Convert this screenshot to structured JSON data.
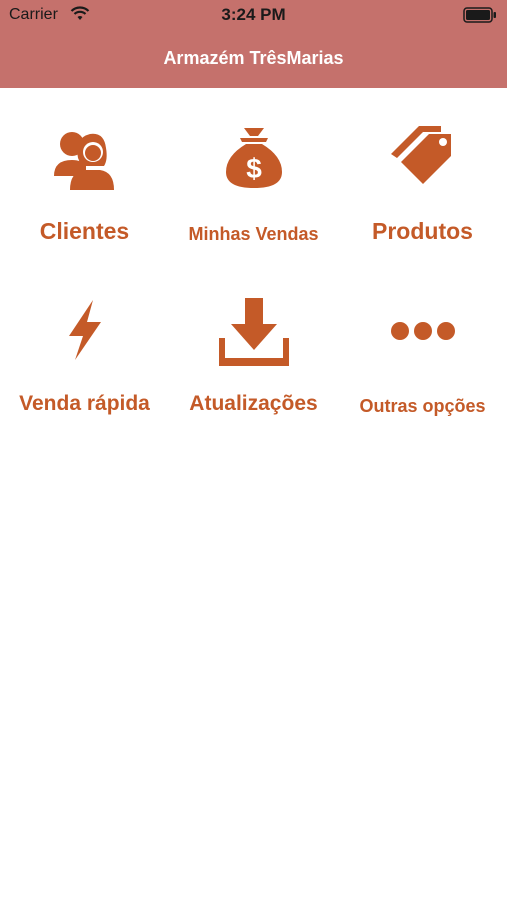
{
  "status_bar": {
    "carrier": "Carrier",
    "time": "3:24 PM"
  },
  "header": {
    "title": "Armazém TrêsMarias"
  },
  "menu": {
    "clientes": {
      "label": "Clientes",
      "icon": "people-icon"
    },
    "minhas_vendas": {
      "label": "Minhas Vendas",
      "icon": "money-bag-icon"
    },
    "produtos": {
      "label": "Produtos",
      "icon": "tags-icon"
    },
    "venda_rapida": {
      "label": "Venda rápida",
      "icon": "lightning-icon"
    },
    "atualizacoes": {
      "label": "Atualizações",
      "icon": "download-icon"
    },
    "outras_opcoes": {
      "label": "Outras opções",
      "icon": "more-dots-icon"
    }
  },
  "colors": {
    "header": "#c5716c",
    "accent": "#c45a28",
    "background": "#ffffff"
  }
}
